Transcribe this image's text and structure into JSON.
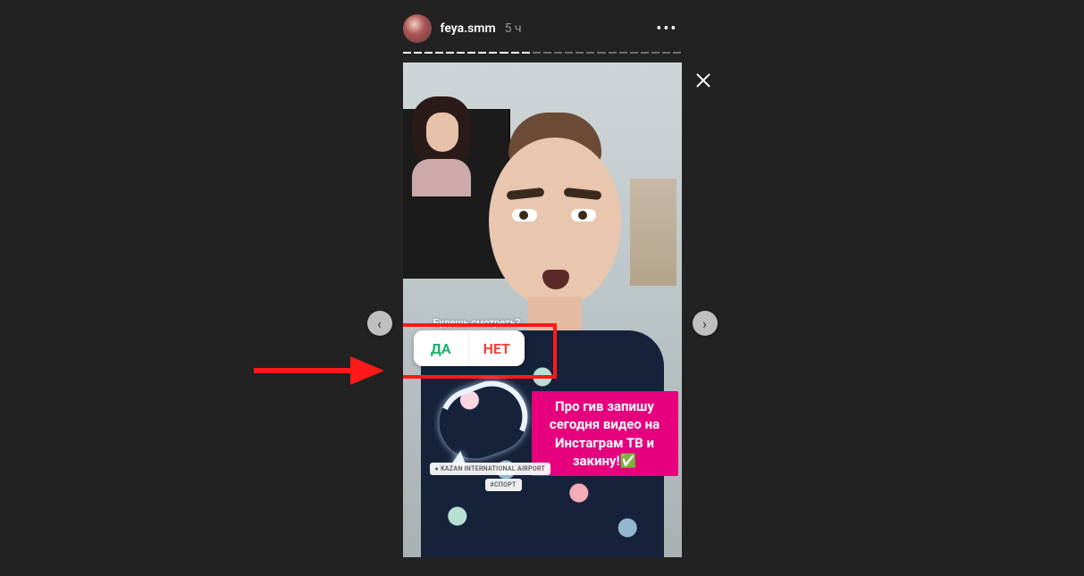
{
  "header": {
    "username": "feya.smm",
    "time": "5 ч",
    "more": "•••"
  },
  "progress": {
    "total": 26,
    "done": 12
  },
  "poll": {
    "question": "Будешь смотреть?",
    "yes": "ДА",
    "no": "НЕТ"
  },
  "note": "Про гив запишу сегодня видео на Инстаграм ТВ и закину!✅",
  "location": "● KAZAN INTERNATIONAL AIRPORT",
  "hashtag": "#СПОРТ",
  "nav": {
    "prev": "‹",
    "next": "›"
  },
  "colors": {
    "accent_pink": "#e6007e",
    "poll_yes": "#17b26a",
    "poll_no": "#f04438",
    "annotation": "#ff1a1a"
  }
}
